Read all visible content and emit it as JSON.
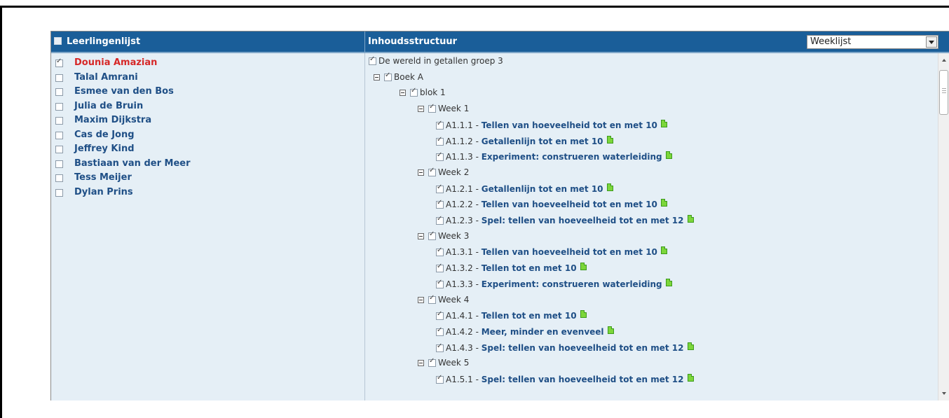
{
  "left_panel": {
    "header": "Leerlingenlijst",
    "students": [
      {
        "name": "Dounia Amazian",
        "checked": true,
        "selected": true
      },
      {
        "name": "Talal Amrani",
        "checked": false,
        "selected": false
      },
      {
        "name": "Esmee van den Bos",
        "checked": false,
        "selected": false
      },
      {
        "name": "Julia de Bruin",
        "checked": false,
        "selected": false
      },
      {
        "name": "Maxim Dijkstra",
        "checked": false,
        "selected": false
      },
      {
        "name": "Cas de Jong",
        "checked": false,
        "selected": false
      },
      {
        "name": "Jeffrey Kind",
        "checked": false,
        "selected": false
      },
      {
        "name": "Bastiaan van der Meer",
        "checked": false,
        "selected": false
      },
      {
        "name": "Tess Meijer",
        "checked": false,
        "selected": false
      },
      {
        "name": "Dylan Prins",
        "checked": false,
        "selected": false
      }
    ]
  },
  "right_panel": {
    "header": "Inhoudsstructuur",
    "view_select": {
      "value": "Weeklijst"
    },
    "tree": {
      "root": "De wereld in getallen groep 3",
      "book": "Boek A",
      "block": "blok 1",
      "weeks": [
        {
          "label": "Week 1",
          "lessons": [
            {
              "code": "A1.1.1",
              "title": "Tellen van hoeveelheid tot en met 10"
            },
            {
              "code": "A1.1.2",
              "title": "Getallenlijn tot en met 10"
            },
            {
              "code": "A1.1.3",
              "title": "Experiment: construeren waterleiding"
            }
          ]
        },
        {
          "label": "Week 2",
          "lessons": [
            {
              "code": "A1.2.1",
              "title": "Getallenlijn tot en met 10"
            },
            {
              "code": "A1.2.2",
              "title": "Tellen van hoeveelheid tot en met 10"
            },
            {
              "code": "A1.2.3",
              "title": "Spel: tellen van hoeveelheid tot en met 12"
            }
          ]
        },
        {
          "label": "Week 3",
          "lessons": [
            {
              "code": "A1.3.1",
              "title": "Tellen van hoeveelheid tot en met 10"
            },
            {
              "code": "A1.3.2",
              "title": "Tellen tot en met 10"
            },
            {
              "code": "A1.3.3",
              "title": "Experiment: construeren waterleiding"
            }
          ]
        },
        {
          "label": "Week 4",
          "lessons": [
            {
              "code": "A1.4.1",
              "title": "Tellen tot en met 10"
            },
            {
              "code": "A1.4.2",
              "title": "Meer, minder en evenveel"
            },
            {
              "code": "A1.4.3",
              "title": "Spel: tellen van hoeveelheid tot en met 12"
            }
          ]
        },
        {
          "label": "Week 5",
          "lessons": [
            {
              "code": "A1.5.1",
              "title": "Spel: tellen van hoeveelheid tot en met 12"
            }
          ]
        }
      ]
    }
  },
  "icons": {
    "lesson": "document-icon",
    "collapse": "minus-box-icon",
    "checkbox": "checkbox-icon"
  },
  "colors": {
    "header_bg": "#1a5e99",
    "panel_bg": "#e5eff6",
    "selected_student": "#d62828",
    "link": "#1f4f86",
    "doc_icon": "#7cd63a"
  }
}
